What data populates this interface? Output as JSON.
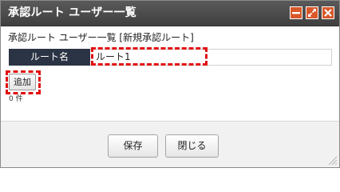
{
  "window": {
    "title": "承認ルート ユーザー一覧",
    "accent_color": "#d9582a",
    "icons": [
      "minimize-icon",
      "maximize-icon",
      "close-icon"
    ]
  },
  "content": {
    "heading": "承認ルート ユーザー一覧 [新規承認ルート]",
    "route_name_label": "ルート名",
    "route_name_value": "ルート1",
    "add_label": "追加",
    "count_text": "0 件"
  },
  "footer": {
    "save_label": "保存",
    "close_label": "閉じる"
  }
}
